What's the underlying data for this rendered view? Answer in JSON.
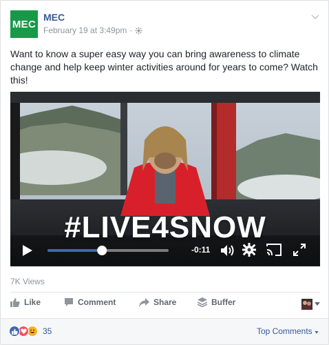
{
  "post": {
    "page_name": "MEC",
    "logo_text": "MEC",
    "date": "February 19 at 3:49pm",
    "separator": "·",
    "text": "Want to know a super easy way you can bring awareness to climate change and help keep winter activities around for years to come? Watch this!"
  },
  "video": {
    "hashtag": "#LIVE4SNOW",
    "time_remaining": "-0:11",
    "progress": 0.45
  },
  "stats": {
    "views": "7K Views",
    "reaction_count": "35"
  },
  "actions": {
    "like": "Like",
    "comment": "Comment",
    "share": "Share",
    "buffer": "Buffer"
  },
  "comments": {
    "sort_label": "Top Comments"
  },
  "colors": {
    "brand_green": "#169a48",
    "link_blue": "#365899",
    "progress_blue": "#4267b2"
  },
  "icons": [
    "globe-icon",
    "chevron-down-icon",
    "play-icon",
    "volume-icon",
    "gear-icon",
    "cast-icon",
    "fullscreen-icon",
    "like-icon",
    "comment-icon",
    "share-icon",
    "buffer-icon",
    "caret-down-icon"
  ]
}
